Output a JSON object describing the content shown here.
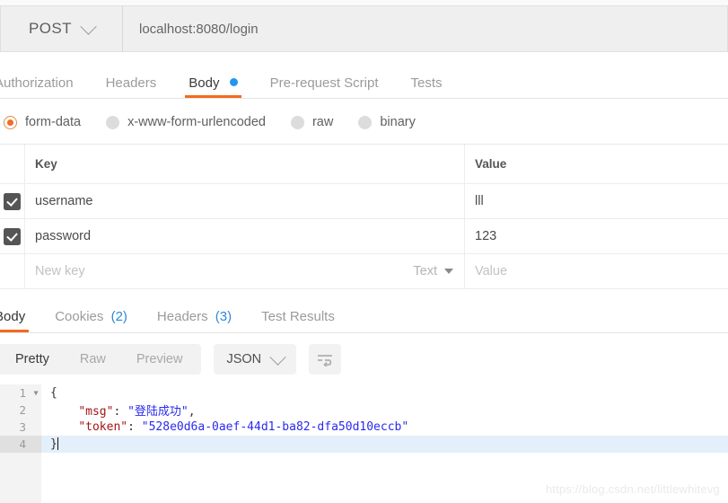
{
  "request_bar": {
    "method": "POST",
    "method_caret_icon": "chevron-down-icon",
    "url": "localhost:8080/login"
  },
  "request_tabs": [
    {
      "label": "Authorization",
      "active": false,
      "has_dot": false
    },
    {
      "label": "Headers",
      "active": false,
      "has_dot": false
    },
    {
      "label": "Body",
      "active": true,
      "has_dot": true
    },
    {
      "label": "Pre-request Script",
      "active": false,
      "has_dot": false
    },
    {
      "label": "Tests",
      "active": false,
      "has_dot": false
    }
  ],
  "body_type_options": [
    {
      "label": "form-data",
      "selected": true
    },
    {
      "label": "x-www-form-urlencoded",
      "selected": false
    },
    {
      "label": "raw",
      "selected": false
    },
    {
      "label": "binary",
      "selected": false
    }
  ],
  "params_table": {
    "headers": {
      "key": "Key",
      "value": "Value"
    },
    "rows": [
      {
        "checked": true,
        "key": "username",
        "value": "lll"
      },
      {
        "checked": true,
        "key": "password",
        "value": "123"
      }
    ],
    "new_row": {
      "key_placeholder": "New key",
      "value_placeholder": "Value",
      "type_label": "Text",
      "type_caret_icon": "triangle-down-icon"
    }
  },
  "response_tabs": [
    {
      "label": "Body",
      "count": "",
      "active": true
    },
    {
      "label": "Cookies",
      "count": "(2)",
      "active": false
    },
    {
      "label": "Headers",
      "count": "(3)",
      "active": false
    },
    {
      "label": "Test Results",
      "count": "",
      "active": false
    }
  ],
  "view_toolbar": {
    "segments": [
      {
        "label": "Pretty",
        "active": true
      },
      {
        "label": "Raw",
        "active": false
      },
      {
        "label": "Preview",
        "active": false
      }
    ],
    "format": "JSON",
    "format_caret_icon": "chevron-down-icon",
    "wrap_button_icon": "word-wrap-icon"
  },
  "response_body": {
    "language": "json",
    "lines": [
      {
        "num": "1",
        "foldable": true,
        "active": false,
        "text": "{"
      },
      {
        "num": "2",
        "foldable": false,
        "active": false,
        "text": "    \"msg\": \"登陆成功\","
      },
      {
        "num": "3",
        "foldable": false,
        "active": false,
        "text": "    \"token\": \"528e0d6a-0aef-44d1-ba82-dfa50d10eccb\""
      },
      {
        "num": "4",
        "foldable": false,
        "active": true,
        "text": "}"
      }
    ],
    "parsed": {
      "msg": "登陆成功",
      "token": "528e0d6a-0aef-44d1-ba82-dfa50d10eccb"
    }
  },
  "watermark": "https://blog.csdn.net/littlewhitevg",
  "colors": {
    "accent_orange": "#f26b21",
    "tab_dot_blue": "#2196f3",
    "count_blue": "#2f88d8",
    "json_key": "#a31515",
    "json_string": "#2a2aee",
    "checkbox": "#555555",
    "active_line": "#e3effb"
  }
}
